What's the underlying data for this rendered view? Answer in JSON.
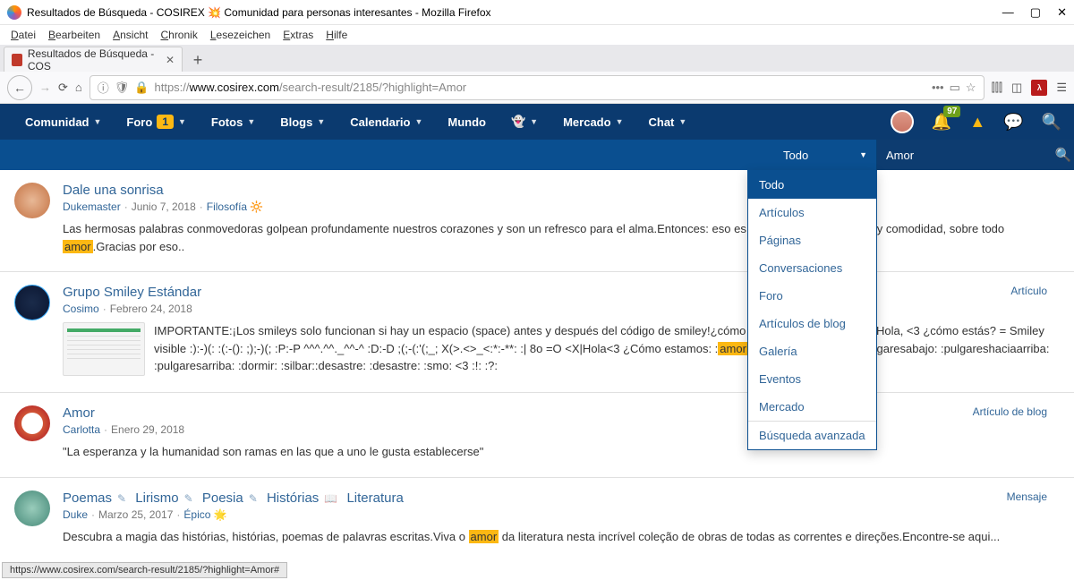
{
  "window": {
    "title": "Resultados de Búsqueda - COSIREX 💥 Comunidad para personas interesantes - Mozilla Firefox",
    "tab_label": "Resultados de Búsqueda - COS",
    "status": "https://www.cosirex.com/search-result/2185/?highlight=Amor#"
  },
  "menubar": [
    "Datei",
    "Bearbeiten",
    "Ansicht",
    "Chronik",
    "Lesezeichen",
    "Extras",
    "Hilfe"
  ],
  "url": {
    "domain": "www.cosirex.com",
    "path": "/search-result/2185/?highlight=Amor",
    "prefix": "https://"
  },
  "nav": {
    "items": [
      {
        "label": "Comunidad",
        "caret": true
      },
      {
        "label": "Foro",
        "badge": "1",
        "caret": true
      },
      {
        "label": "Fotos",
        "caret": true
      },
      {
        "label": "Blogs",
        "caret": true
      },
      {
        "label": "Calendario",
        "caret": true
      },
      {
        "label": "Mundo"
      },
      {
        "label": "👻",
        "caret": true
      },
      {
        "label": "Mercado",
        "caret": true
      },
      {
        "label": "Chat",
        "caret": true
      }
    ],
    "notif_count": "97"
  },
  "search": {
    "trigger": "Todo",
    "value": "Amor",
    "options": [
      "Todo",
      "Artículos",
      "Páginas",
      "Conversaciones",
      "Foro",
      "Artículos de blog",
      "Galería",
      "Eventos",
      "Mercado"
    ],
    "advanced": "Búsqueda avanzada"
  },
  "results": [
    {
      "title": "Dale una sonrisa",
      "author": "Dukemaster",
      "date": "Junio 7, 2018",
      "cat": "Filosofía 🔆",
      "snippet_pre": "Las hermosas palabras conmovedoras golpean profundamente nuestros corazones y son un refresco para el alma.Entonces: eso es fortalecimiento, refresco y comodidad, sobre todo ",
      "hl": "amor",
      "snippet_post": ".Gracias por eso.."
    },
    {
      "title": "Grupo Smiley Estándar",
      "author": "Cosimo",
      "date": "Febrero 24, 2018",
      "tag": "Artículo",
      "snippet_pre": "IMPORTANTE:¡Los smileys solo funcionan si hay un espacio (space) antes y después del código de smiley!¿cómo estás? = Smiley invisibleHola, <3 ¿cómo estás? = Smiley visible :):-)(: :(:-(): ;);-)(; :P:-P ^^^.^^._^^-^ :D:-D ;(;-(:'(;_; X(>.<>_<:*:-**: :| 8o =O <X|Hola<3 ¿Cómo estamos: :",
      "hl": "amor",
      "snippet_post": ": 8|o.O :maldiciendo: :pulgaresabajo: :pulgareshaciaarriba: :pulgaresarriba: :dormir: :silbar::desastre: :desastre: :smo: <3 :!: :?:"
    },
    {
      "title": "Amor",
      "author": "Carlotta",
      "date": "Enero 29, 2018",
      "tag": "Artículo de blog",
      "snippet_pre": "\"La esperanza y la humanidad son ramas en las que a uno le gusta establecerse\"",
      "hl": "",
      "snippet_post": ""
    },
    {
      "title_parts": [
        "Poemas",
        "Lirismo",
        "Poesia",
        "Histórias",
        "Literatura"
      ],
      "author": "Duke",
      "date": "Marzo 25, 2017",
      "cat": "Épico 🌟",
      "tag": "Mensaje",
      "snippet_pre": "Descubra a magia das histórias, histórias, poemas de palavras escritas.Viva o ",
      "hl": "amor",
      "snippet_post": " da literatura nesta incrível coleção de obras de todas as correntes e direções.Encontre-se aqui..."
    }
  ]
}
